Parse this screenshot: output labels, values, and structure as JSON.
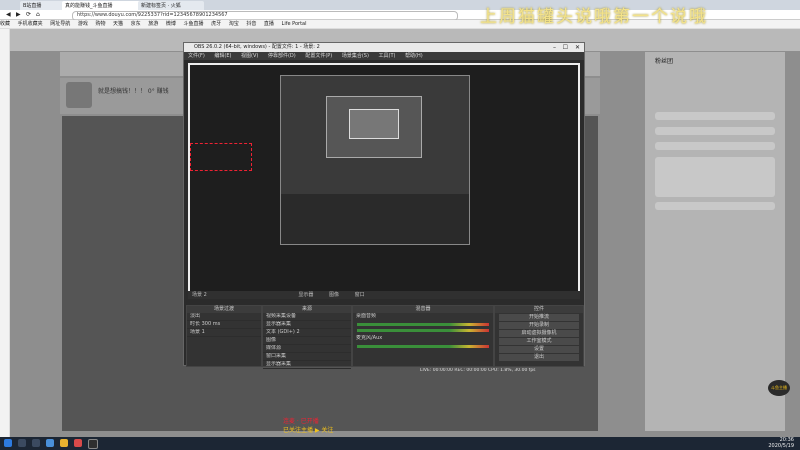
{
  "browser": {
    "tabs": [
      {
        "label": "B站直播"
      },
      {
        "label": "真的能赚钱_斗鱼直播"
      },
      {
        "label": "新建标签页 · 火狐"
      }
    ],
    "url": "https://www.douyu.com/9225337?rid=12345678901234567",
    "bookmarks": [
      "收藏",
      "手机收藏夹",
      "网址导航",
      "游戏",
      "购物",
      "天猫",
      "京东",
      "旅游",
      "微博",
      "斗鱼直播",
      "虎牙",
      "淘宝",
      "抖音",
      "直播",
      "Life Portal"
    ]
  },
  "overlay": {
    "title": "上周猫罐头说哦第一个说哦"
  },
  "obs": {
    "window_title": "OBS 26.0.2 (64-bit, windows) - 配置文件: 1 - 场景: 2",
    "menu": [
      "文件(F)",
      "编辑(E)",
      "视图(V)",
      "停靠部件(D)",
      "配置文件(P)",
      "场景集合(S)",
      "工具(T)",
      "帮助(H)"
    ],
    "preview_tabs": [
      "属性",
      "滤镜"
    ],
    "toolbar_labels": [
      "场景 2",
      "属性",
      "滤镜",
      "显示器",
      "图像",
      "窗口"
    ],
    "docks": {
      "scenes": {
        "title": "场景过渡",
        "rows": [
          "淡出",
          "时长 300 ms",
          "场景 1"
        ]
      },
      "sources": {
        "title": "来源",
        "rows": [
          "视频采集设备",
          "显示器采集",
          "文本 (GDI+) 2",
          "图像",
          "媒体源",
          "窗口采集",
          "显示器采集",
          "媒体源"
        ]
      },
      "mixer": {
        "title": "混音器",
        "channels": [
          "桌面音频",
          "麦克风/Aux"
        ]
      },
      "controls": {
        "title": "控件",
        "buttons": [
          "开始推流",
          "开始录制",
          "启动虚拟摄像机",
          "工作室模式",
          "设置",
          "退出"
        ]
      }
    },
    "status": "LIVE: 00:00:00   REC: 00:00:00   CPU: 1.8%, 30.00 fps"
  },
  "douyu": {
    "streamer_name": "就是想搞钱！！！ 0° 赚钱",
    "chat_header": "粉丝团",
    "bottom_red_text": "连麦 · 已开播",
    "bottom_yellow_text": "已关注主播 ▶ 关注",
    "badge_text": "斗鱼主播"
  },
  "taskbar": {
    "time": "20:36",
    "date": "2020/5/19"
  },
  "colors": {
    "overlay_yellow": "#f3e28a",
    "obs_dark": "#2b2b2b",
    "red_accent": "#e23333",
    "yellow_accent": "#f2c21b"
  }
}
